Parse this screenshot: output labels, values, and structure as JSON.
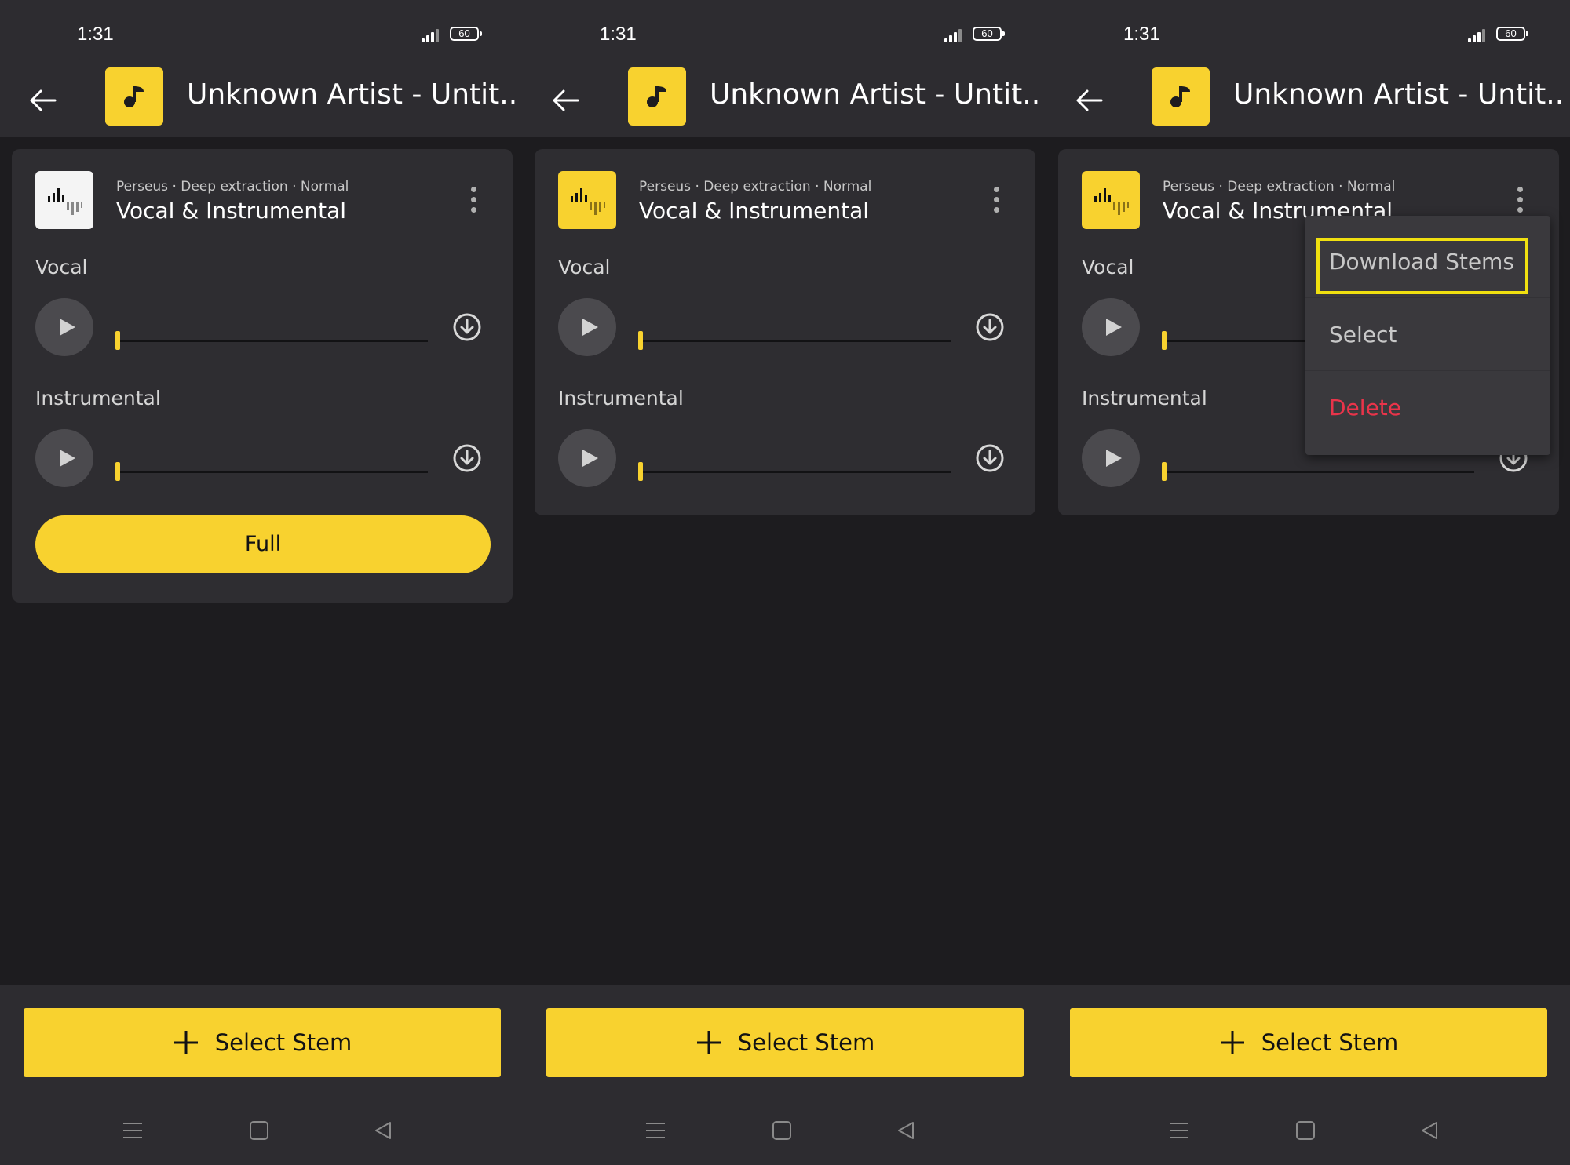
{
  "colors": {
    "accent": "#f8d22f",
    "background": "#1d1c1f",
    "surface": "#2d2c30",
    "card": "#2e2d31",
    "danger": "#e9344a",
    "highlight": "#f0e010"
  },
  "panels": [
    {
      "status": {
        "time": "1:31",
        "battery": "60"
      },
      "appbar": {
        "title": "Unknown Artist - Untit..."
      },
      "card": {
        "meta": "Perseus · Deep extraction · Normal",
        "title": "Vocal & Instrumental",
        "tracks": [
          {
            "label": "Vocal",
            "progress": 0
          },
          {
            "label": "Instrumental",
            "progress": 0
          }
        ],
        "full_label": "Full"
      },
      "bottom": {
        "select_stem_label": "Select Stem"
      }
    },
    {
      "status": {
        "time": "1:31",
        "battery": "60"
      },
      "appbar": {
        "title": "Unknown Artist - Untit..."
      },
      "card": {
        "meta": "Perseus · Deep extraction · Normal",
        "title": "Vocal & Instrumental",
        "tracks": [
          {
            "label": "Vocal",
            "progress": 0
          },
          {
            "label": "Instrumental",
            "progress": 0
          }
        ]
      },
      "bottom": {
        "select_stem_label": "Select Stem"
      }
    },
    {
      "status": {
        "time": "1:31",
        "battery": "60"
      },
      "appbar": {
        "title": "Unknown Artist - Untit..."
      },
      "card": {
        "meta": "Perseus · Deep extraction · Normal",
        "title": "Vocal & Instrumental",
        "tracks": [
          {
            "label": "Vocal",
            "progress": 0
          },
          {
            "label": "Instrumental",
            "progress": 0
          }
        ]
      },
      "menu": {
        "items": [
          {
            "label": "Download Stems",
            "highlighted": true
          },
          {
            "label": "Select"
          },
          {
            "label": "Delete"
          }
        ]
      },
      "bottom": {
        "select_stem_label": "Select Stem"
      }
    }
  ]
}
